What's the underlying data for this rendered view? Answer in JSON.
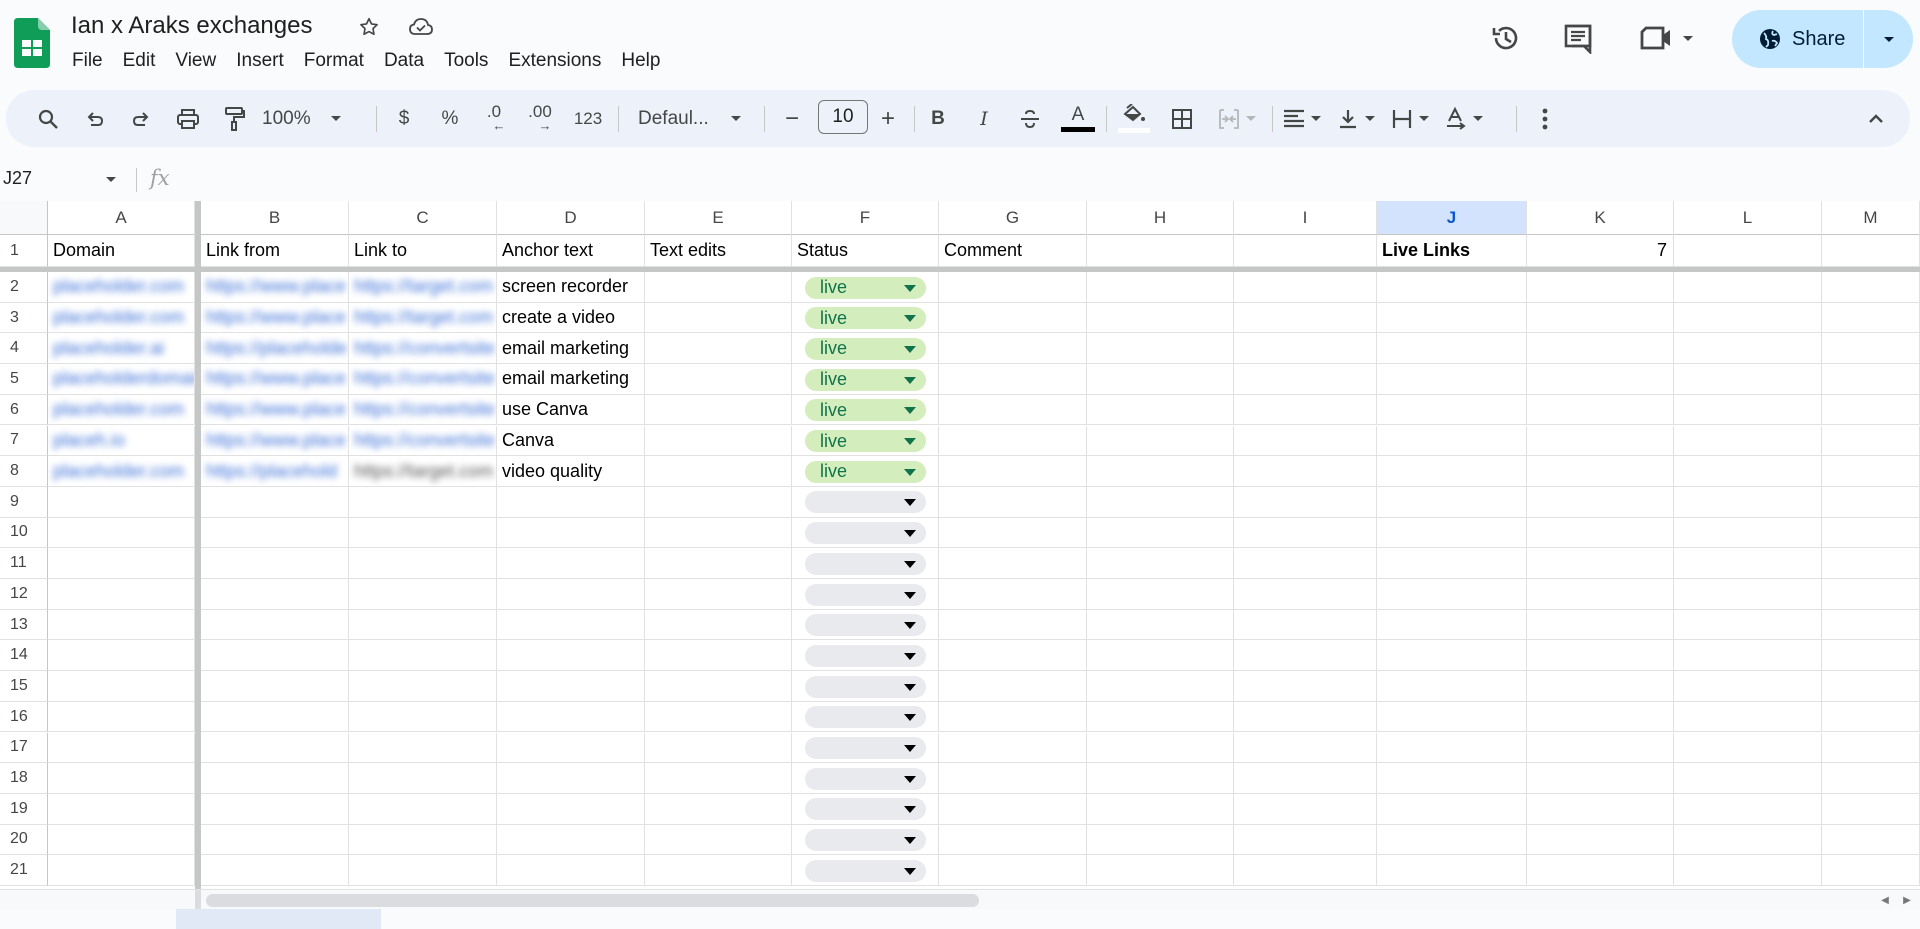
{
  "app": {
    "title": "Ian x Araks exchanges",
    "menus": [
      "File",
      "Edit",
      "View",
      "Insert",
      "Format",
      "Data",
      "Tools",
      "Extensions",
      "Help"
    ],
    "share_label": "Share",
    "icons": {
      "star": "star-icon",
      "cloud": "cloud-saved-icon",
      "history": "version-history-icon",
      "comments": "comments-icon",
      "meet": "video-call-icon",
      "globe": "globe-icon"
    }
  },
  "toolbar": {
    "zoom": "100%",
    "currency": "$",
    "percent": "%",
    "decrease_decimals": ".0",
    "increase_decimals": ".00",
    "number_format": "123",
    "font": "Defaul...",
    "font_size": "10",
    "minus": "−",
    "plus": "+",
    "bold": "B",
    "italic": "I",
    "text_color": "A",
    "text_color_value": "#000000",
    "fill_color_value": "#ffffff"
  },
  "formula_bar": {
    "name_box": "J27",
    "fx": "fx",
    "formula": ""
  },
  "sheet": {
    "columns": [
      "A",
      "B",
      "C",
      "D",
      "E",
      "F",
      "G",
      "H",
      "I",
      "J",
      "K",
      "L",
      "M"
    ],
    "selected_column": "J",
    "header_row": {
      "row_number": "1",
      "cells": [
        "Domain",
        "Link from",
        "Link to",
        "Anchor text",
        "Text edits",
        "Status",
        "Comment",
        "",
        "",
        "Live Links",
        "7",
        "",
        ""
      ]
    },
    "rows": [
      {
        "n": "2",
        "domain": "placeholder.com",
        "link_from": "https://www.place",
        "link_to": "https://target.com",
        "anchor": "screen recorder",
        "status": "live"
      },
      {
        "n": "3",
        "domain": "placeholder.com",
        "link_from": "https://www.place",
        "link_to": "https://target.com",
        "anchor": "create a video",
        "status": "live"
      },
      {
        "n": "4",
        "domain": "placeholder.ai",
        "link_from": "https://placeholde",
        "link_to": "https://convertsite",
        "anchor": "email marketing",
        "status": "live"
      },
      {
        "n": "5",
        "domain": "placeholderdomain",
        "link_from": "https://www.place",
        "link_to": "https://convertsite",
        "anchor": "email marketing",
        "status": "live"
      },
      {
        "n": "6",
        "domain": "placeholder.com",
        "link_from": "https://www.place",
        "link_to": "https://convertsite",
        "anchor": "use Canva",
        "status": "live"
      },
      {
        "n": "7",
        "domain": "placeh.io",
        "link_from": "https://www.place",
        "link_to": "https://convertsite",
        "anchor": "Canva",
        "status": "live"
      },
      {
        "n": "8",
        "domain": "placeholder.com",
        "link_from": "https://placehold",
        "link_to": "https://target.com",
        "anchor": "video quality",
        "status": "live"
      },
      {
        "n": "9",
        "status": ""
      },
      {
        "n": "10",
        "status": ""
      },
      {
        "n": "11",
        "status": ""
      },
      {
        "n": "12",
        "status": ""
      },
      {
        "n": "13",
        "status": ""
      },
      {
        "n": "14",
        "status": ""
      },
      {
        "n": "15",
        "status": ""
      },
      {
        "n": "16",
        "status": ""
      },
      {
        "n": "17",
        "status": ""
      },
      {
        "n": "18",
        "status": ""
      },
      {
        "n": "19",
        "status": ""
      },
      {
        "n": "20",
        "status": ""
      },
      {
        "n": "21",
        "status": ""
      }
    ],
    "status_colors": {
      "live_bg": "#d4edbc",
      "live_text": "#11734b",
      "empty_bg": "#e8eaed"
    }
  }
}
